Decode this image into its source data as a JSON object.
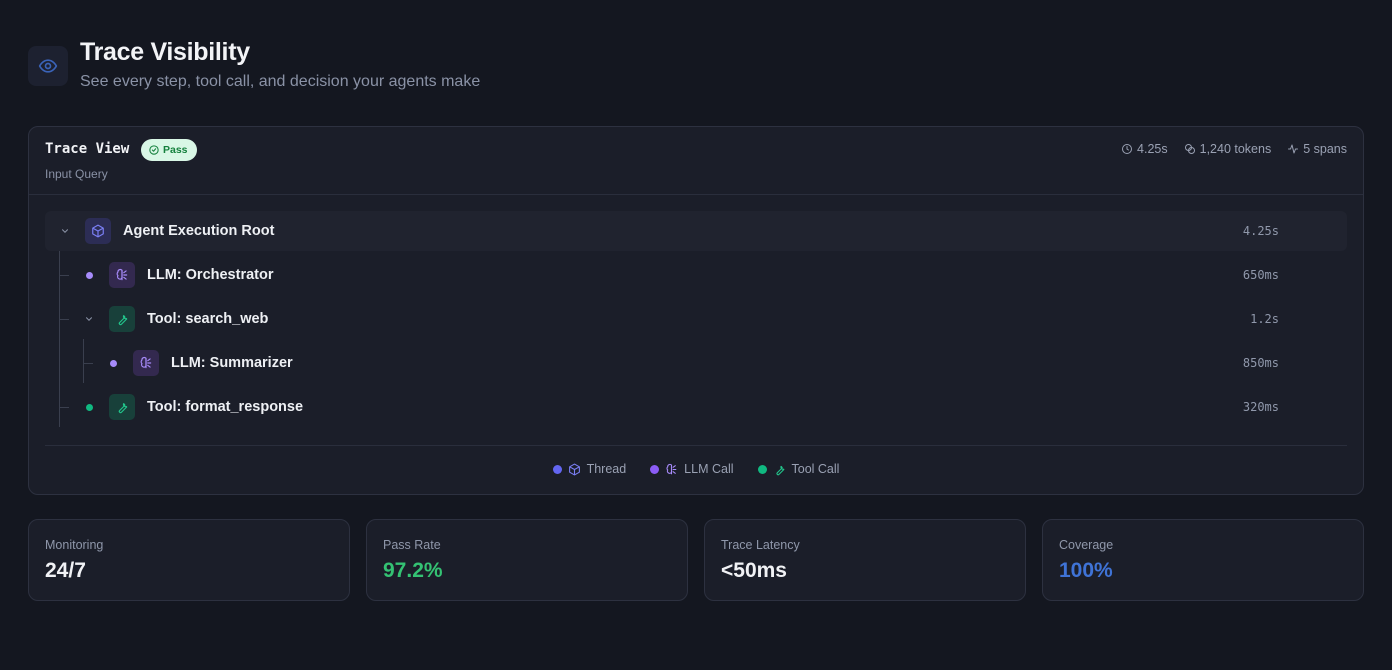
{
  "header": {
    "icon": "eye-icon",
    "title": "Trace Visibility",
    "subtitle": "See every step, tool call, and decision your agents make"
  },
  "trace_view": {
    "title": "Trace View",
    "badge": "Pass",
    "subtitle": "Input Query",
    "stats": {
      "duration": "4.25s",
      "tokens": "1,240 tokens",
      "spans": "5 spans"
    },
    "nodes": [
      {
        "label": "Agent Execution Root",
        "duration": "4.25s",
        "type": "thread",
        "icon": "cube-icon"
      },
      {
        "label": "LLM: Orchestrator",
        "duration": "650ms",
        "type": "llm",
        "icon": "brain-icon"
      },
      {
        "label": "Tool: search_web",
        "duration": "1.2s",
        "type": "tool",
        "icon": "wrench-icon"
      },
      {
        "label": "LLM: Summarizer",
        "duration": "850ms",
        "type": "llm",
        "icon": "brain-icon"
      },
      {
        "label": "Tool: format_response",
        "duration": "320ms",
        "type": "tool",
        "icon": "wrench-icon"
      }
    ],
    "legend": [
      {
        "label": "Thread",
        "color": "#6366f1",
        "icon": "cube-icon"
      },
      {
        "label": "LLM Call",
        "color": "#8b5cf6",
        "icon": "brain-icon"
      },
      {
        "label": "Tool Call",
        "color": "#10b981",
        "icon": "wrench-icon"
      }
    ]
  },
  "metrics": [
    {
      "label": "Monitoring",
      "value": "24/7",
      "color": "#f1f2f5"
    },
    {
      "label": "Pass Rate",
      "value": "97.2%",
      "color": "#34c273"
    },
    {
      "label": "Trace Latency",
      "value": "<50ms",
      "color": "#f1f2f5"
    },
    {
      "label": "Coverage",
      "value": "100%",
      "color": "#3f73d6"
    }
  ],
  "colors": {
    "background": "#141720",
    "panel": "#1b1e29",
    "thread": "#6366f1",
    "llm": "#a78bfa",
    "tool": "#10b981",
    "pass_badge_bg": "#d9f7e6",
    "pass_badge_fg": "#15803d"
  }
}
